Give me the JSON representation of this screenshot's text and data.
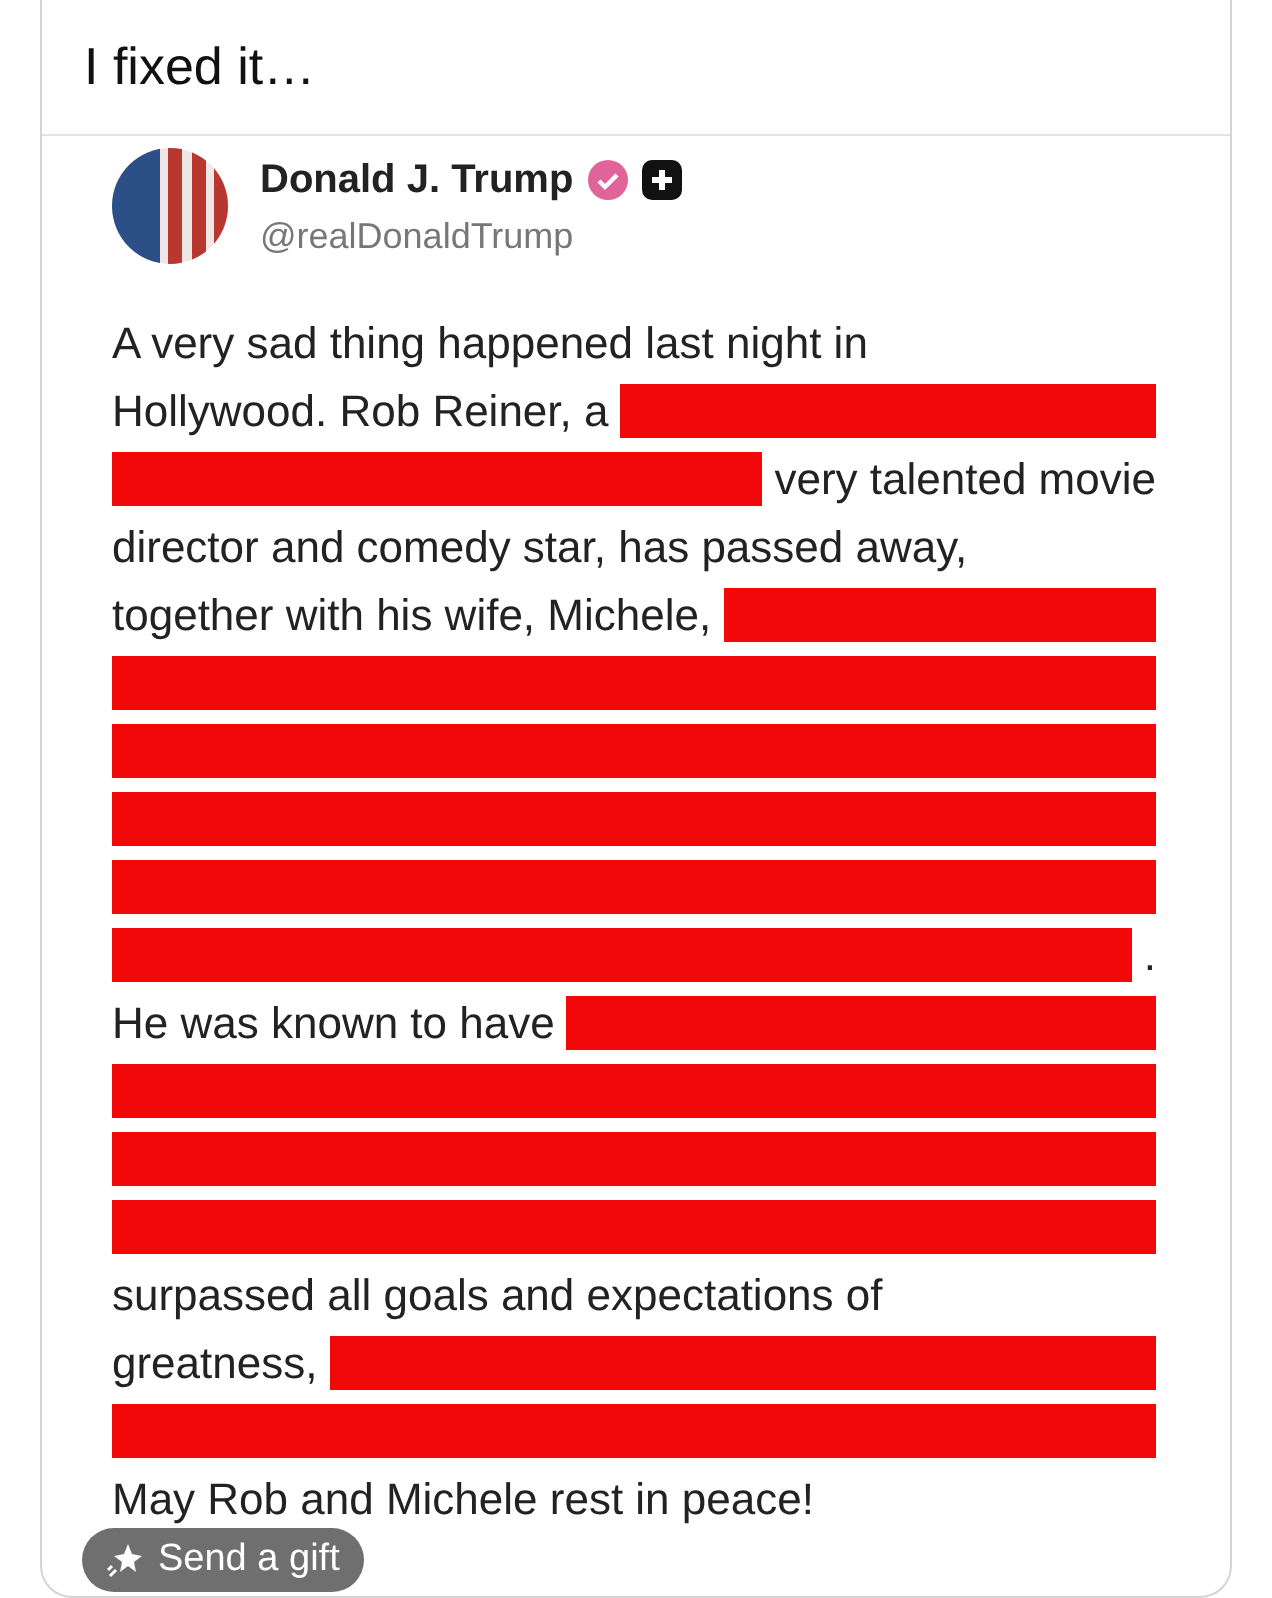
{
  "post": {
    "caption": "I fixed it…"
  },
  "tweet": {
    "author_name": "Donald J. Trump",
    "handle": "@realDonaldTrump",
    "verified": true,
    "lines": [
      {
        "segments": [
          {
            "kind": "text",
            "text": "A very sad thing happened last night in"
          }
        ]
      },
      {
        "segments": [
          {
            "kind": "text",
            "text": "Hollywood. Rob Reiner, a"
          },
          {
            "kind": "redaction"
          }
        ]
      },
      {
        "segments": [
          {
            "kind": "redaction"
          },
          {
            "kind": "text",
            "text": "very talented movie"
          }
        ]
      },
      {
        "segments": [
          {
            "kind": "text",
            "text": "director and comedy star, has passed away,"
          }
        ]
      },
      {
        "segments": [
          {
            "kind": "text",
            "text": "together with his wife, Michele,"
          },
          {
            "kind": "redaction"
          }
        ]
      },
      {
        "segments": [
          {
            "kind": "redaction"
          }
        ]
      },
      {
        "segments": [
          {
            "kind": "redaction"
          }
        ]
      },
      {
        "segments": [
          {
            "kind": "redaction"
          }
        ]
      },
      {
        "segments": [
          {
            "kind": "redaction"
          }
        ]
      },
      {
        "segments": [
          {
            "kind": "redaction"
          },
          {
            "kind": "text",
            "text": "."
          }
        ]
      },
      {
        "segments": [
          {
            "kind": "text",
            "text": "He was known to have"
          },
          {
            "kind": "redaction"
          }
        ]
      },
      {
        "segments": [
          {
            "kind": "redaction"
          }
        ]
      },
      {
        "segments": [
          {
            "kind": "redaction"
          }
        ]
      },
      {
        "segments": [
          {
            "kind": "redaction"
          }
        ]
      },
      {
        "segments": [
          {
            "kind": "text",
            "text": "surpassed all goals and expectations of"
          }
        ]
      },
      {
        "segments": [
          {
            "kind": "text",
            "text": "greatness,"
          },
          {
            "kind": "redaction"
          }
        ]
      },
      {
        "segments": [
          {
            "kind": "redaction"
          }
        ]
      },
      {
        "segments": [
          {
            "kind": "text",
            "text": "May Rob and Michele rest in peace!"
          }
        ]
      }
    ]
  },
  "gift_button": {
    "label": "Send a gift"
  }
}
